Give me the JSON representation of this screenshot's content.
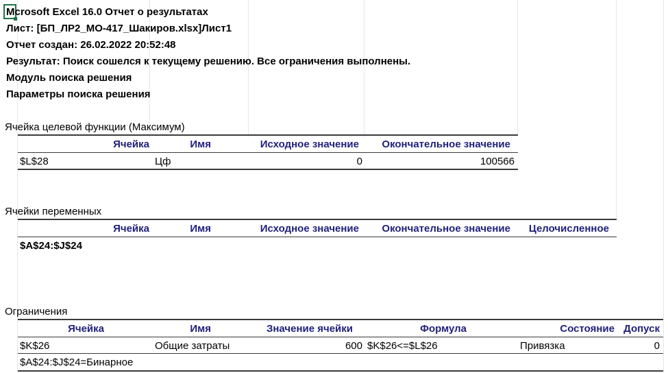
{
  "report": {
    "title": "Microsoft Excel 16.0 Отчет о результатах",
    "title_first_char": "M",
    "title_rest": "crosoft Excel 16.0 Отчет о результатах",
    "sheet": "Лист: [БП_ЛР2_МО-417_Шакиров.xlsx]Лист1",
    "created": "Отчет создан: 26.02.2022 20:52:48",
    "result": "Результат: Поиск сошелся к текущему решению. Все ограничения выполнены.",
    "module": "Модуль поиска решения",
    "params": "Параметры поиска решения"
  },
  "objective": {
    "section_title": "Ячейка целевой функции (Максимум)",
    "headers": [
      "Ячейка",
      "Имя",
      "Исходное значение",
      "Окончательное значение"
    ],
    "rows": [
      {
        "cell": "$L$28",
        "name": "Цф",
        "original": "0",
        "final": "100566"
      }
    ]
  },
  "variables": {
    "section_title": "Ячейки переменных",
    "headers": [
      "Ячейка",
      "Имя",
      "Исходное значение",
      "Окончательное значение",
      "Целочисленное"
    ],
    "range": "$A$24:$J$24"
  },
  "constraints": {
    "section_title": "Ограничения",
    "headers": [
      "Ячейка",
      "Имя",
      "Значение ячейки",
      "Формула",
      "Состояние",
      "Допуск"
    ],
    "rows": [
      {
        "cell": "$K$26",
        "name": "Общие затраты",
        "value": "600",
        "formula": "$K$26<=$L$26",
        "status": "Привязка",
        "slack": "0"
      }
    ],
    "extra": "$A$24:$J$24=Бинарное"
  },
  "colors": {
    "header_text": "#1f1f7a",
    "gridline": "#e6e6e6",
    "selection": "#217346"
  }
}
